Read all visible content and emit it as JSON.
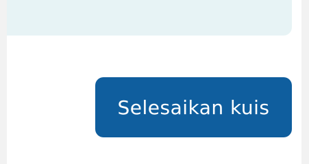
{
  "colors": {
    "page_background": "#f2f2f2",
    "card_background": "#ffffff",
    "info_strip": "#e7f3f5",
    "primary_button": "#0f5e9e",
    "primary_button_text": "#ffffff"
  },
  "quiz": {
    "finish_label": "Selesaikan kuis"
  }
}
